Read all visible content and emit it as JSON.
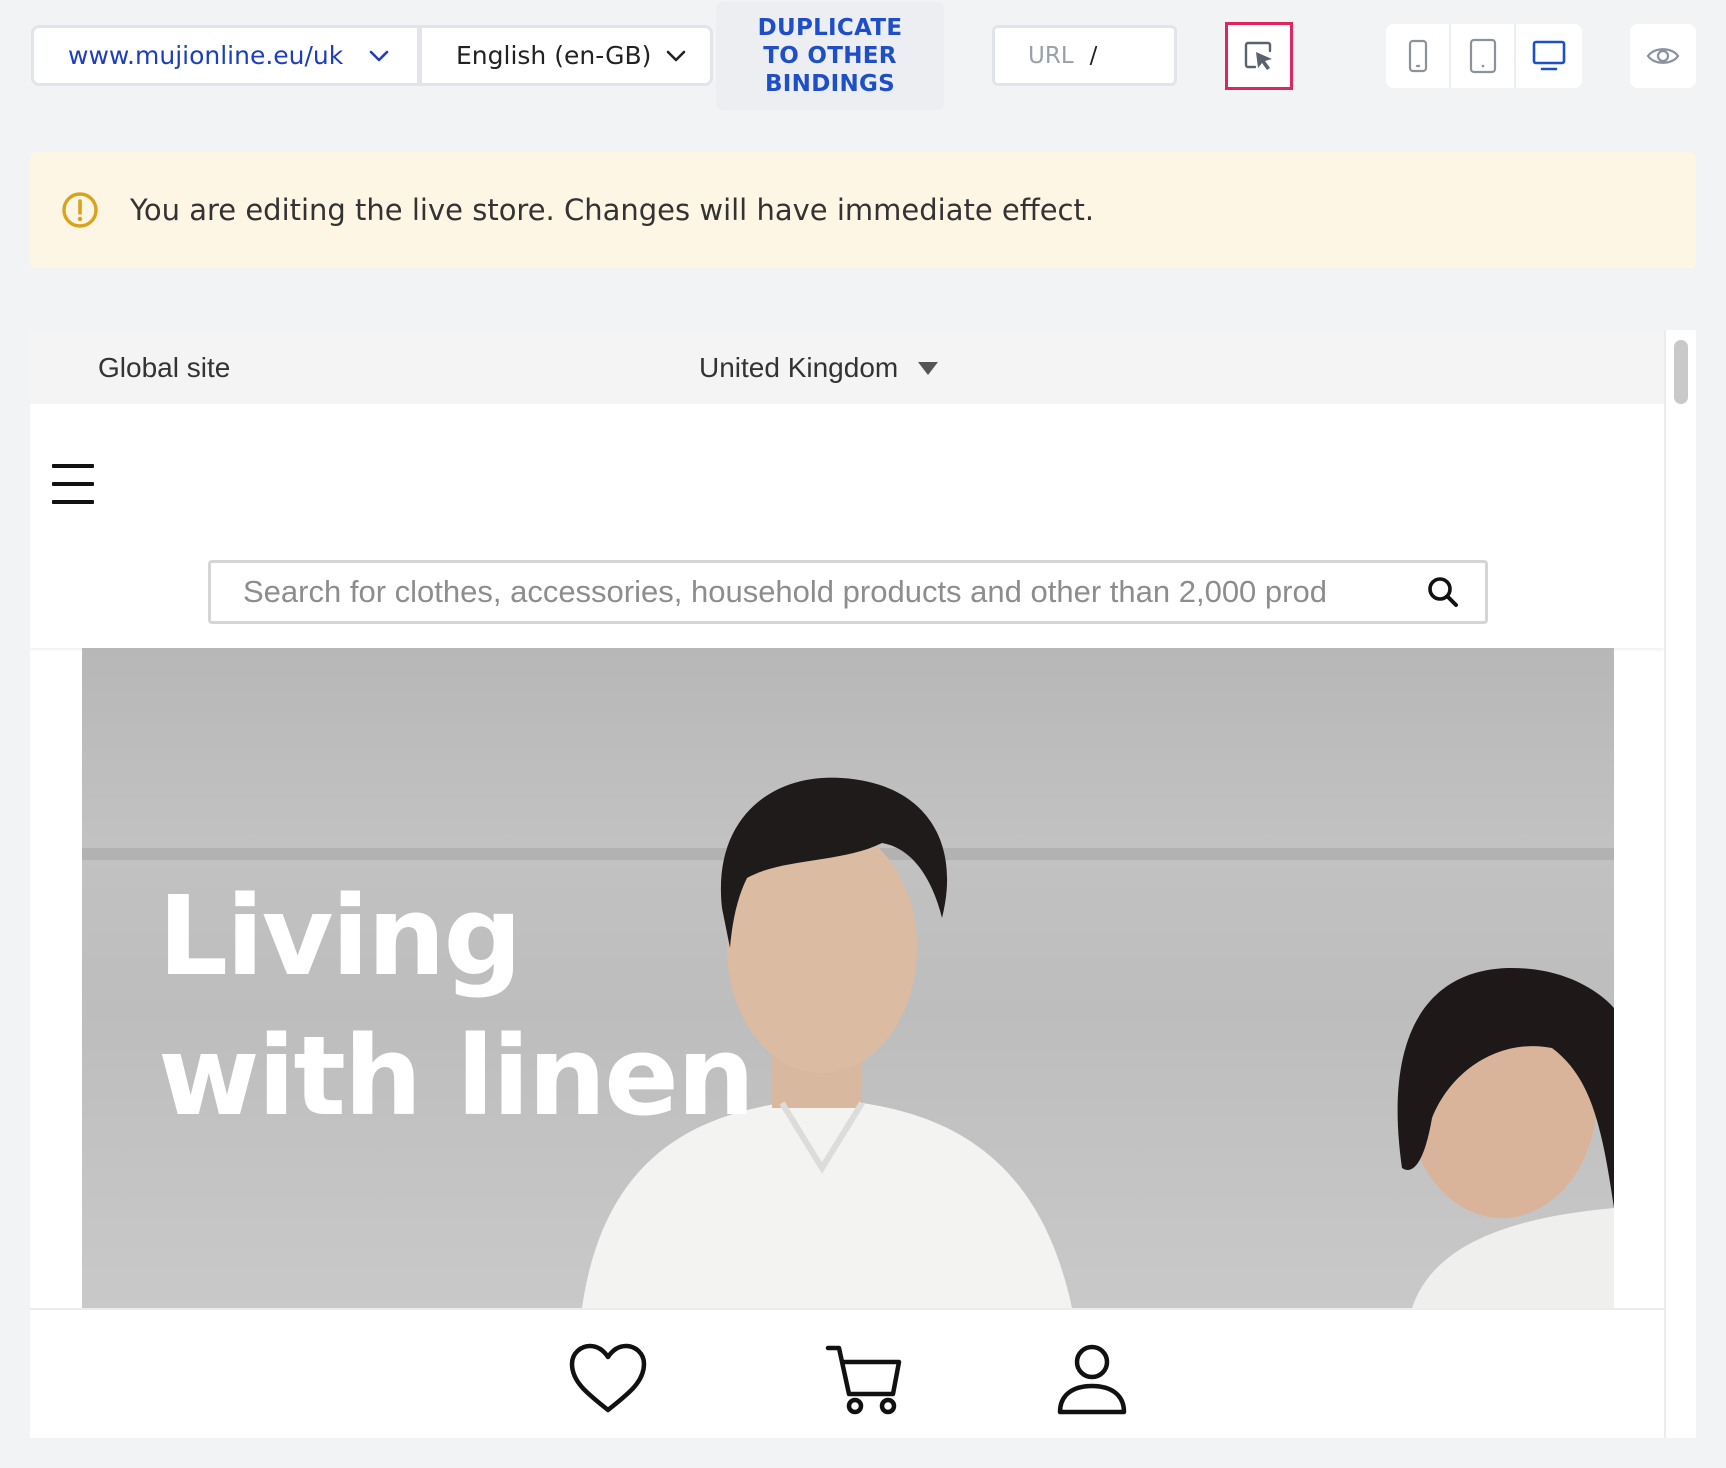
{
  "toolbar": {
    "site_select": "www.mujionline.eu/uk",
    "language_select": "English (en-GB)",
    "duplicate_button": [
      "DUPLICATE",
      "TO OTHER",
      "BINDINGS"
    ],
    "url_label": "URL",
    "url_value": "/",
    "active_device": "desktop",
    "accent_color": "#1f4fc8",
    "select_tool_highlight": "#e0245e"
  },
  "warning": {
    "text": "You are editing the live store. Changes will have immediate effect.",
    "icon": "exclamation-circle-icon",
    "color": "#d9a21b"
  },
  "store": {
    "topbar": {
      "global_site": "Global site",
      "country": "United Kingdom"
    },
    "search": {
      "placeholder": "Search for clothes, accessories, household products and other than 2,000 prod"
    },
    "hero": {
      "line1": "Living",
      "line2": "with linen"
    },
    "bottom_nav": [
      "heart-icon",
      "cart-icon",
      "user-icon"
    ]
  }
}
